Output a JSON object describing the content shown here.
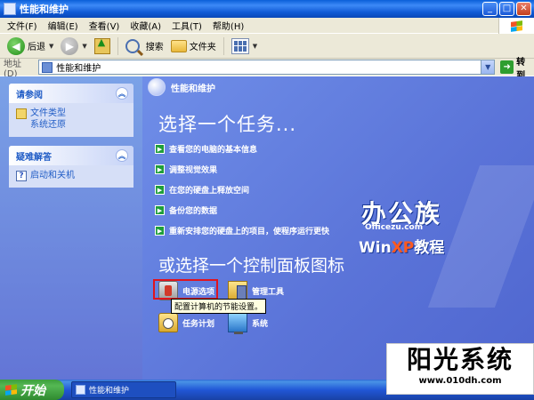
{
  "window": {
    "title": "性能和维护"
  },
  "menubar": {
    "items": [
      "文件(F)",
      "编辑(E)",
      "查看(V)",
      "收藏(A)",
      "工具(T)",
      "帮助(H)"
    ]
  },
  "toolbar": {
    "back_label": "后退",
    "search_label": "搜索",
    "folders_label": "文件夹"
  },
  "addressbar": {
    "label": "地址(D)",
    "value": "性能和维护",
    "go_label": "转到"
  },
  "sidebar": {
    "boxes": [
      {
        "title": "请参阅",
        "links": [
          "文件类型",
          "系统还原"
        ]
      },
      {
        "title": "疑难解答",
        "links": [
          "启动和关机"
        ]
      }
    ]
  },
  "main": {
    "header_title": "性能和维护",
    "task_heading": "选择一个任务...",
    "tasks": [
      "查看您的电脑的基本信息",
      "调整视觉效果",
      "在您的硬盘上释放空间",
      "备份您的数据",
      "重新安排您的硬盘上的项目，使程序运行更快"
    ],
    "panel_heading": "或选择一个控制面板图标",
    "panel_icons": [
      "电源选项",
      "管理工具",
      "任务计划",
      "系统"
    ],
    "tooltip": "配置计算机的节能设置。"
  },
  "watermarks": {
    "office_text": "办公族",
    "office_url": "Officezu.com",
    "winxp_prefix": "Win",
    "winxp_xp": "XP",
    "winxp_suffix": "教程"
  },
  "taskbar": {
    "start_label": "开始",
    "window_label": "性能和维护"
  },
  "stamp": {
    "title": "阳光系统",
    "url": "www.010dh.com"
  }
}
